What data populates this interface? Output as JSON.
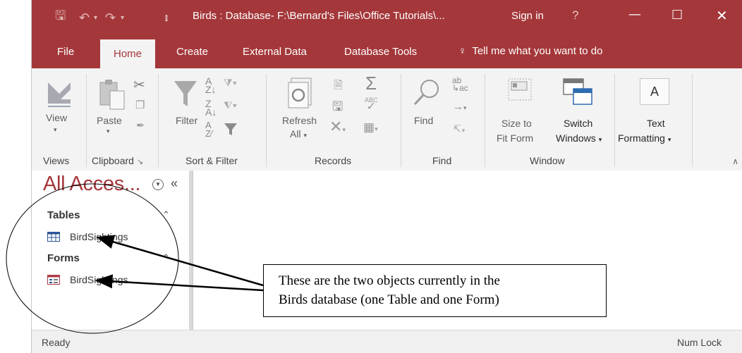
{
  "titlebar": {
    "title": "Birds : Database- F:\\Bernard's Files\\Office Tutorials\\...",
    "sign_in": "Sign in",
    "help": "?",
    "save_icon": "save-icon",
    "undo_icon": "undo-icon",
    "redo_icon": "redo-icon"
  },
  "tabs": {
    "file": "File",
    "home": "Home",
    "create": "Create",
    "external_data": "External Data",
    "database_tools": "Database Tools",
    "tell_me": "Tell me what you want to do"
  },
  "ribbon": {
    "view": "View",
    "paste": "Paste",
    "filter": "Filter",
    "refresh": "Refresh",
    "refresh_all": "All",
    "find": "Find",
    "size_to": "Size to",
    "fit_form": "Fit Form",
    "switch": "Switch",
    "windows": "Windows",
    "text": "Text",
    "formatting": "Formatting",
    "groups": {
      "views": "Views",
      "clipboard": "Clipboard",
      "sort_filter": "Sort & Filter",
      "records": "Records",
      "find": "Find",
      "window": "Window"
    }
  },
  "nav": {
    "title": "All Acces...",
    "tables_header": "Tables",
    "table_item": "BirdSightings",
    "forms_header": "Forms",
    "form_item": "BirdSightings"
  },
  "status": {
    "left": "Ready",
    "right": "Num Lock"
  },
  "annotation": {
    "line1": "These are the two objects currently in the",
    "line2": "Birds database (one Table and one Form)"
  },
  "colors": {
    "accent": "#a4373a",
    "ribbon_bg": "#f3f3f3"
  }
}
